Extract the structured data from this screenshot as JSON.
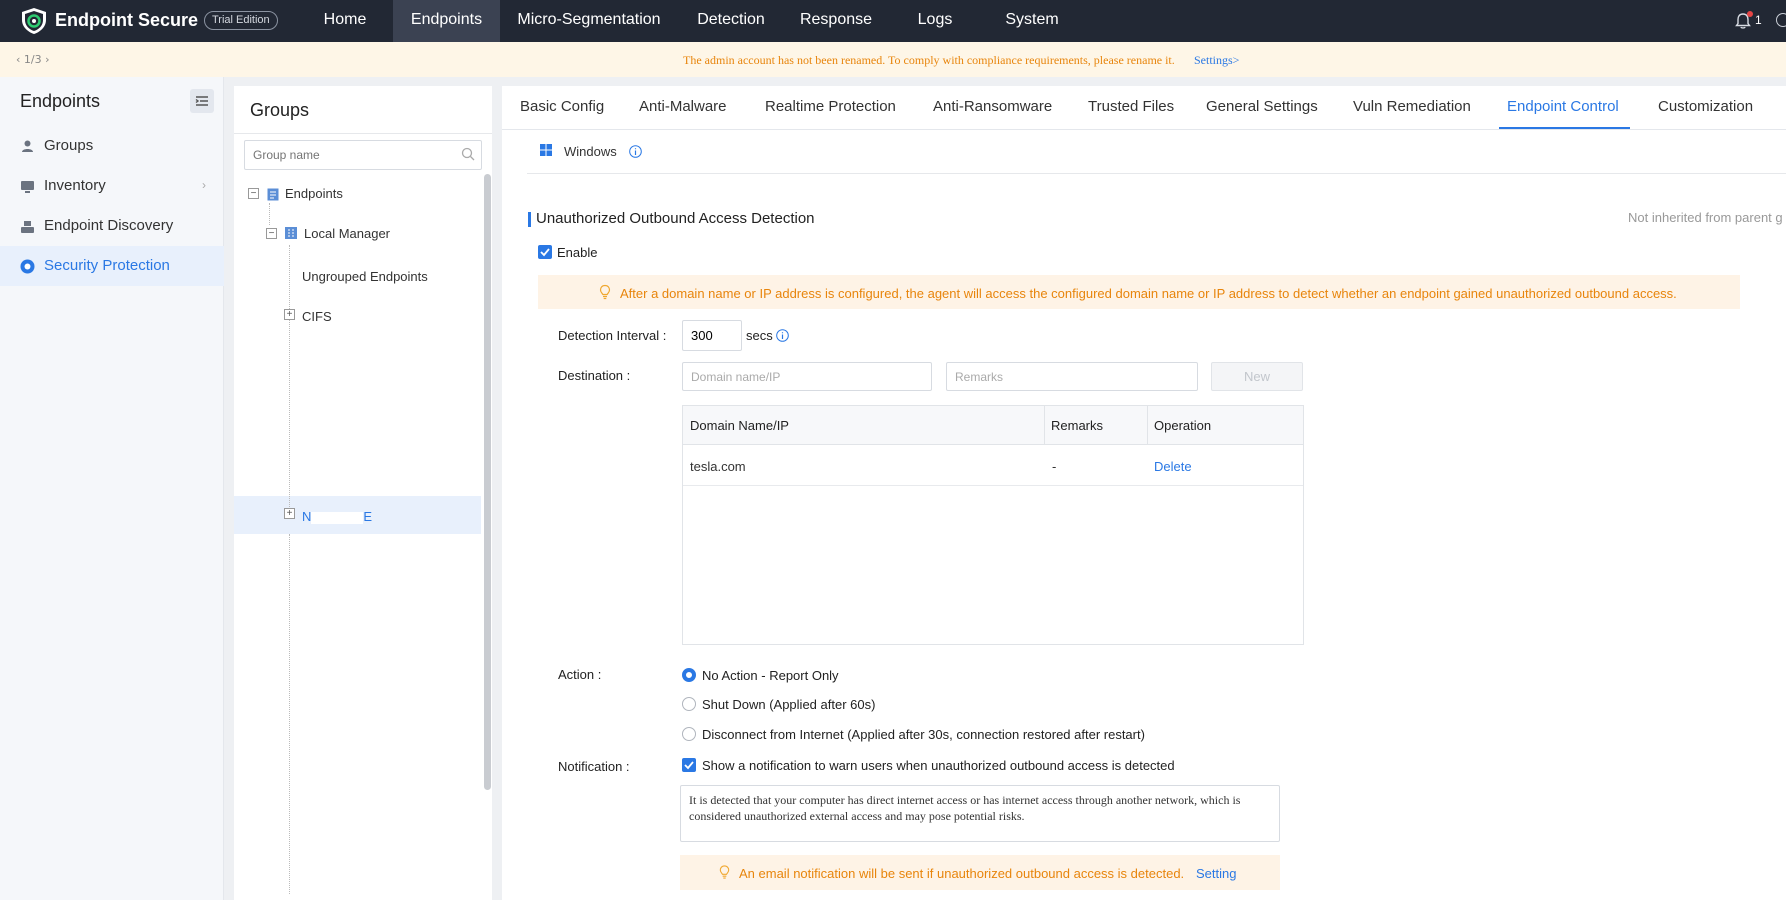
{
  "topbar": {
    "brand": "Endpoint Secure",
    "trial_badge": "Trial Edition",
    "nav": [
      "Home",
      "Endpoints",
      "Micro-Segmentation",
      "Detection",
      "Response",
      "Logs",
      "System"
    ],
    "active_nav": "Endpoints",
    "notification_count": "1"
  },
  "notice": {
    "pager": "1/3",
    "message": "The admin account has not been renamed. To comply with compliance requirements, please rename it.",
    "link": "Settings>"
  },
  "sidebar": {
    "title": "Endpoints",
    "items": [
      {
        "label": "Groups",
        "icon": "groups-icon"
      },
      {
        "label": "Inventory",
        "icon": "inventory-icon"
      },
      {
        "label": "Endpoint Discovery",
        "icon": "discovery-icon"
      },
      {
        "label": "Security Protection",
        "icon": "shield-icon"
      }
    ],
    "active": "Security Protection"
  },
  "groups": {
    "title": "Groups",
    "search_placeholder": "Group name",
    "tree": {
      "root": "Endpoints",
      "manager": "Local Manager",
      "ungrouped": "Ungrouped Endpoints",
      "cifs": "CIFS",
      "selected_fragment_a": "N",
      "selected_fragment_b": "E"
    }
  },
  "tabs": [
    "Basic Config",
    "Anti-Malware",
    "Realtime Protection",
    "Anti-Ransomware",
    "Trusted Files",
    "General Settings",
    "Vuln Remediation",
    "Endpoint Control",
    "Customization"
  ],
  "active_tab": "Endpoint Control",
  "os": "Windows",
  "section": {
    "title": "Unauthorized Outbound Access Detection",
    "inherit_note": "Not inherited from parent g",
    "enable_label": "Enable",
    "enabled": true,
    "info_banner": "After a domain name or IP address is configured, the agent will access the configured domain name or IP address to detect whether an endpoint gained unauthorized outbound access."
  },
  "form": {
    "interval_label": "Detection Interval :",
    "interval_value": "300",
    "interval_unit": "secs",
    "destination_label": "Destination :",
    "domain_placeholder": "Domain name/IP",
    "remarks_placeholder": "Remarks",
    "new_button": "New",
    "table": {
      "headers": [
        "Domain Name/IP",
        "Remarks",
        "Operation"
      ],
      "rows": [
        {
          "domain": "tesla.com",
          "remarks": "-",
          "operation": "Delete"
        }
      ]
    },
    "action_label": "Action :",
    "actions": [
      {
        "label": "No Action - Report Only",
        "selected": true
      },
      {
        "label": "Shut Down (Applied after 60s)",
        "selected": false
      },
      {
        "label": "Disconnect from Internet (Applied after 30s, connection restored after restart)",
        "selected": false
      }
    ],
    "notification_label": "Notification :",
    "notification_checkbox": "Show a notification to warn users when unauthorized outbound access is detected",
    "notification_checked": true,
    "notification_message": "It is detected that your computer has direct internet access or has internet access through another network, which is considered unauthorized external access and may pose potential risks.",
    "email_banner": "An email notification will be sent if unauthorized outbound access is detected.",
    "email_link": "Setting"
  },
  "colors": {
    "accent": "#2a78e4",
    "topbar": "#222834",
    "warning_text": "#e8850c",
    "warning_bg": "#fef3e6"
  }
}
